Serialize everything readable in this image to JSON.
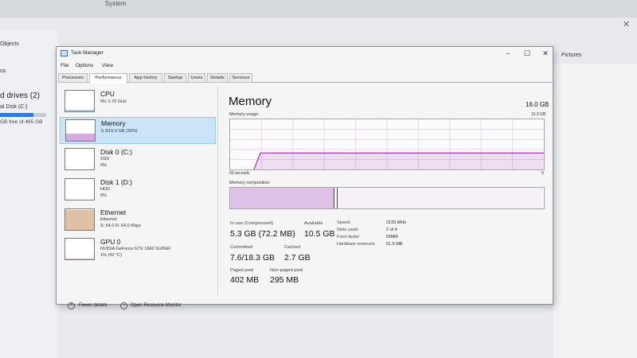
{
  "background": {
    "top_label": "System",
    "nav_objects": "Objects",
    "nav_os": "os",
    "drives_header": "d drives (2)",
    "disk_label": "al Disk (C:)",
    "disk_free": "GB free of 465 GB",
    "pictures": "Pictures"
  },
  "window": {
    "title": "Task Manager",
    "minimize": "–",
    "maximize": "☐",
    "close": "✕"
  },
  "menu": [
    "File",
    "Options",
    "View"
  ],
  "tabs": [
    "Processes",
    "Performance",
    "App history",
    "Startup",
    "Users",
    "Details",
    "Services"
  ],
  "active_tab": "Performance",
  "sidebar": [
    {
      "name": "CPU",
      "line1": "9%  3.70 GHz",
      "line2": "",
      "usage": 0.09,
      "color": "#117dbb"
    },
    {
      "name": "Memory",
      "line1": "5.3/15.9 GB (35%)",
      "line2": "",
      "usage": 0.35,
      "color": "#8b12ae"
    },
    {
      "name": "Disk 0 (C:)",
      "line1": "SSD",
      "line2": "0%",
      "usage": 0.0,
      "color": "#4da60c"
    },
    {
      "name": "Disk 1 (D:)",
      "line1": "HDD",
      "line2": "0%",
      "usage": 0.0,
      "color": "#4da60c"
    },
    {
      "name": "Ethernet",
      "line1": "Ethernet",
      "line2": "S: 64.0  R: 64.0 Kbps",
      "usage": 0.95,
      "color": "#a74f01"
    },
    {
      "name": "GPU 0",
      "line1": "NVIDIA GeForce GTX 1660 SUPER",
      "line2": "1% (43 °C)",
      "usage": 0.01,
      "color": "#117dbb"
    }
  ],
  "main": {
    "title": "Memory",
    "total": "16.0 GB",
    "graph_label": "Memory usage",
    "graph_max": "15.9 GB",
    "graph_time": "60 seconds",
    "graph_min": "0",
    "graph_usage": 0.33,
    "composition_label": "Memory composition",
    "composition_in_use": 0.33,
    "composition_modified": 0.01,
    "composition_standby": 0.66,
    "stats": {
      "in_use_label": "In use (Compressed)",
      "in_use_value": "5.3 GB (72.2 MB)",
      "available_label": "Available",
      "available_value": "10.5 GB",
      "committed_label": "Committed",
      "committed_value": "7.6/18.3 GB",
      "cached_label": "Cached",
      "cached_value": "2.7 GB",
      "paged_label": "Paged pool",
      "paged_value": "402 MB",
      "nonpaged_label": "Non-paged pool",
      "nonpaged_value": "295 MB"
    },
    "specs": {
      "speed_label": "Speed:",
      "speed_value": "2133 MHz",
      "slots_label": "Slots used:",
      "slots_value": "2 of 4",
      "form_label": "Form factor:",
      "form_value": "DIMM",
      "reserved_label": "Hardware reserved:",
      "reserved_value": "51.5 MB"
    }
  },
  "footer": {
    "fewer_details": "Fewer details",
    "open_monitor": "Open Resource Monitor"
  },
  "colors": {
    "memory_accent": "#8b12ae",
    "selection": "#cce4f7"
  }
}
